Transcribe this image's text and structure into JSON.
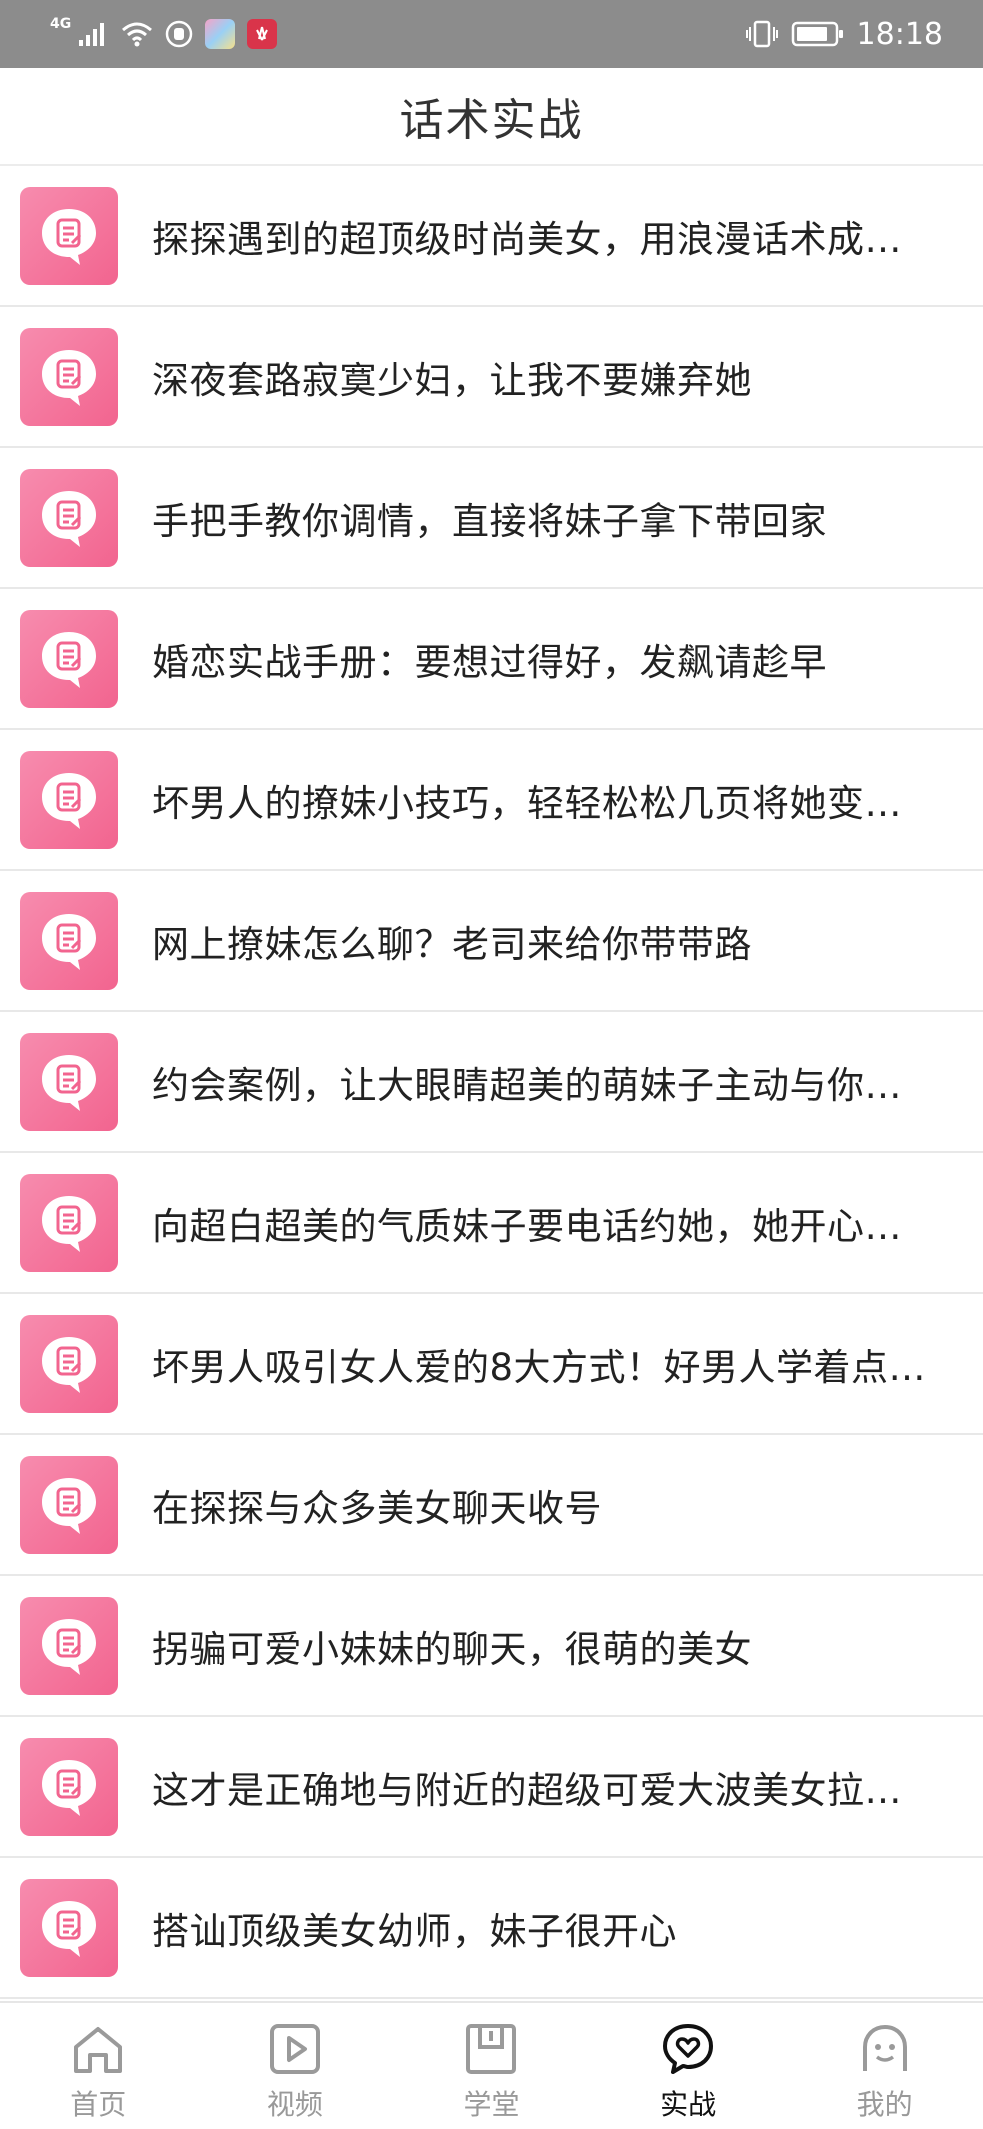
{
  "status_bar": {
    "network": "4G",
    "time": "18:18"
  },
  "header": {
    "title": "话术实战"
  },
  "list": {
    "items": [
      {
        "title": "探探遇到的超顶级时尚美女，用浪漫话术成…"
      },
      {
        "title": "深夜套路寂寞少妇，让我不要嫌弃她"
      },
      {
        "title": "手把手教你调情，直接将妹子拿下带回家"
      },
      {
        "title": "婚恋实战手册：要想过得好，发飙请趁早"
      },
      {
        "title": "坏男人的撩妹小技巧，轻轻松松几页将她变…"
      },
      {
        "title": "网上撩妹怎么聊？老司来给你带带路"
      },
      {
        "title": "约会案例，让大眼睛超美的萌妹子主动与你…"
      },
      {
        "title": "向超白超美的气质妹子要电话约她，她开心…"
      },
      {
        "title": "坏男人吸引女人爱的8大方式！好男人学着点…"
      },
      {
        "title": "在探探与众多美女聊天收号"
      },
      {
        "title": "拐骗可爱小妹妹的聊天，很萌的美女"
      },
      {
        "title": "这才是正确地与附近的超级可爱大波美女拉…"
      },
      {
        "title": "搭讪顶级美女幼师，妹子很开心"
      }
    ],
    "icon": "chat-document-icon",
    "accent_color": "#f2648f"
  },
  "tab_bar": {
    "tabs": [
      {
        "label": "首页",
        "icon": "home-icon"
      },
      {
        "label": "视频",
        "icon": "video-play-icon"
      },
      {
        "label": "学堂",
        "icon": "book-icon"
      },
      {
        "label": "实战",
        "icon": "heart-chat-icon"
      },
      {
        "label": "我的",
        "icon": "user-face-icon"
      }
    ],
    "active_index": 3,
    "active_color": "#111111",
    "inactive_color": "#999999"
  }
}
